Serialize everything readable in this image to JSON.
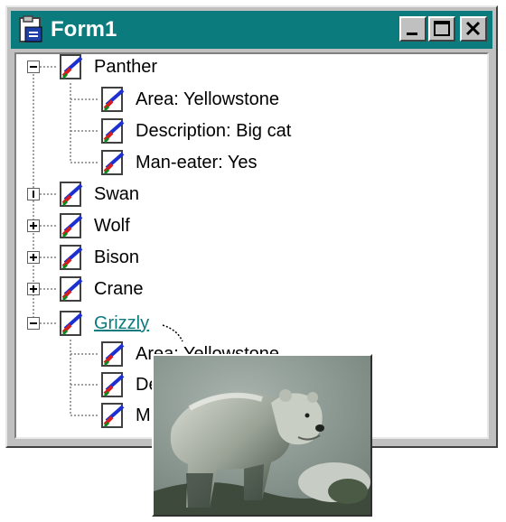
{
  "window": {
    "title": "Form1"
  },
  "tree": {
    "nodes": [
      {
        "label": "Panther",
        "expanded": true,
        "children": [
          {
            "label": "Area: Yellowstone"
          },
          {
            "label": "Description: Big cat"
          },
          {
            "label": "Man-eater: Yes"
          }
        ]
      },
      {
        "label": "Swan",
        "expanded": false
      },
      {
        "label": "Wolf",
        "expanded": false
      },
      {
        "label": "Bison",
        "expanded": false
      },
      {
        "label": "Crane",
        "expanded": false
      },
      {
        "label": "Grizzly",
        "expanded": true,
        "hovered": true,
        "children": [
          {
            "label": "Area: Yellowstone"
          },
          {
            "label": "De"
          },
          {
            "label": "M"
          }
        ]
      }
    ]
  },
  "popup": {
    "subject": "grizzly-bear-photo"
  },
  "colors": {
    "title_bar": "#0b7b7d",
    "link": "#0b7b7d",
    "face": "#c0c0c0"
  }
}
